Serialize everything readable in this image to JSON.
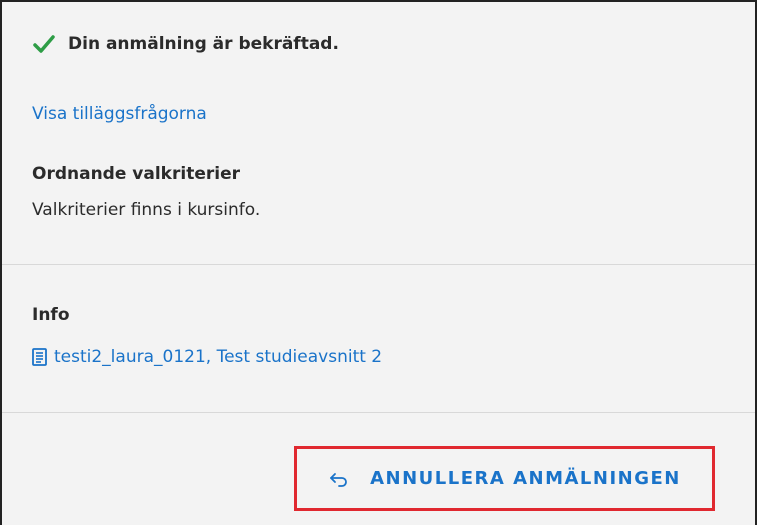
{
  "status": {
    "message": "Din anmälning är bekräftad.",
    "icon": "checkmark-icon",
    "color": "#2e9d46"
  },
  "links": {
    "show_questions": "Visa tilläggsfrågorna",
    "course": "testi2_laura_0121, Test studieavsnitt 2"
  },
  "criteria": {
    "title": "Ordnande valkriterier",
    "text": "Valkriterier finns i kursinfo."
  },
  "info": {
    "title": "Info"
  },
  "actions": {
    "cancel_label": "ANNULLERA ANMÄLNINGEN"
  },
  "colors": {
    "link": "#1a73c9",
    "highlight": "#e0282f",
    "background": "#f3f3f3"
  }
}
